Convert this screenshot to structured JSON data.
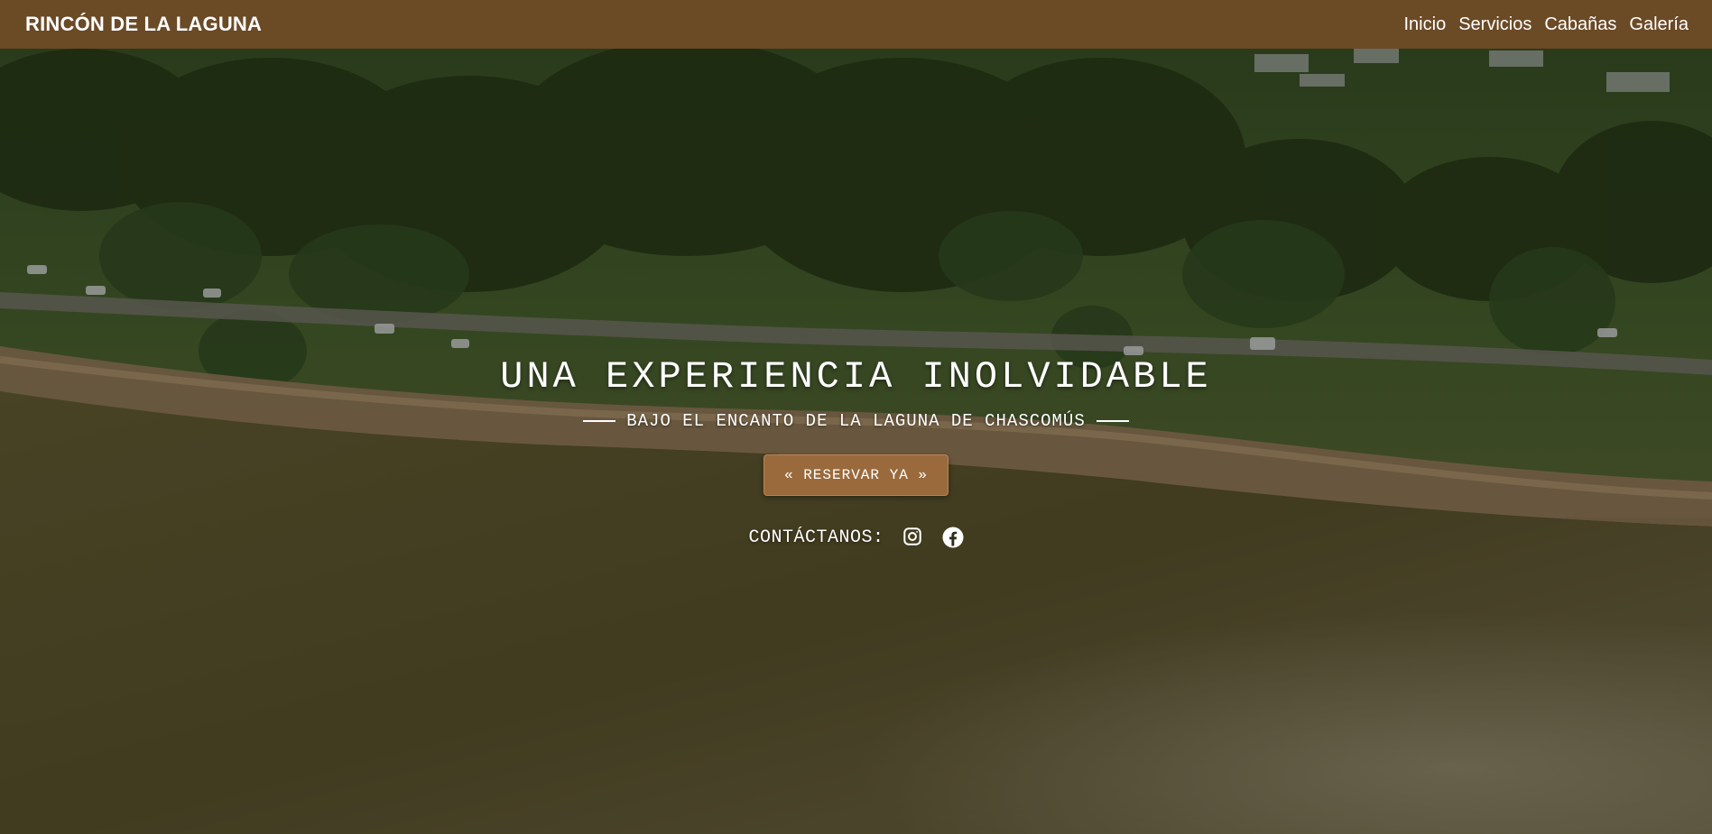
{
  "navbar": {
    "brand": "RINCÓN DE LA LAGUNA",
    "links": [
      "Inicio",
      "Servicios",
      "Cabañas",
      "Galería"
    ],
    "background_color": "#6b4a26"
  },
  "hero": {
    "title": "UNA EXPERIENCIA INOLVIDABLE",
    "subtitle": "BAJO EL ENCANTO DE LA LAGUNA DE CHASCOMÚS",
    "button_label": "« RESERVAR YA »",
    "button_color": "#9a6a3c",
    "contact_label": "CONTÁCTANOS:",
    "social_icons": [
      "instagram-icon",
      "facebook-icon"
    ]
  }
}
